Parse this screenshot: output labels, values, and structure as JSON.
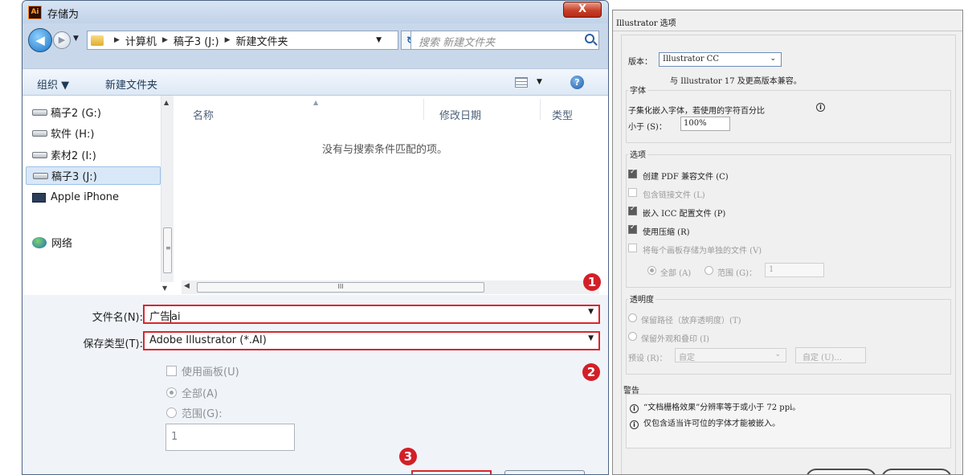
{
  "save_dialog": {
    "title": "存储为",
    "app_icon_text": "Ai",
    "close_glyph": "X",
    "breadcrumb": [
      "计算机",
      "稿子3 (J:)",
      "新建文件夹"
    ],
    "search_placeholder": "搜索 新建文件夹",
    "toolbar": {
      "organize": "组织 ▼",
      "new_folder": "新建文件夹"
    },
    "nav_items": [
      {
        "label": "稿子2 (G:)"
      },
      {
        "label": "软件 (H:)"
      },
      {
        "label": "素材2 (I:)"
      },
      {
        "label": "稿子3 (J:)"
      },
      {
        "label": "Apple iPhone"
      },
      {
        "label": "网络"
      }
    ],
    "columns": {
      "name": "名称",
      "modified": "修改日期",
      "type": "类型"
    },
    "empty_message": "没有与搜索条件匹配的项。",
    "filename_label": "文件名(N):",
    "filename_before_caret": "广告",
    "filename_after_caret": "ai",
    "savetype_label": "保存类型(T):",
    "savetype_value": "Adobe Illustrator (*.AI)",
    "use_artboards": "使用画板(U)",
    "all": "全部(A)",
    "range": "范围(G):",
    "range_value": "1",
    "scroll_mark": "III",
    "split_mark": "≡"
  },
  "badges": [
    "1",
    "2",
    "3"
  ],
  "options_dialog": {
    "title": "Illustrator 选项",
    "version_label": "版本：",
    "version_value": "Illustrator CC",
    "compat_note": "与 Illustrator 17 及更高版本兼容。",
    "fonts_group": "字体",
    "subset_text": "子集化嵌入字体，若使用的字符百分比",
    "less_than": "小于 (S)：",
    "percent_value": "100%",
    "options_group": "选项",
    "opt_pdf": "创建 PDF 兼容文件 (C)",
    "opt_linked": "包含链接文件 (L)",
    "opt_icc": "嵌入 ICC 配置文件 (P)",
    "opt_compress": "使用压缩 (R)",
    "opt_each_artboard": "将每个画板存储为单独的文件 (V)",
    "opt_all": "全部 (A)",
    "opt_range": "范围 (G)：",
    "opt_range_value": "1",
    "transparency_group": "透明度",
    "keep_paths": "保留路径（放弃透明度）(T)",
    "keep_appearance": "保留外观和叠印 (I)",
    "preset_label": "预设 (R)：",
    "preset_value": "自定",
    "custom_button": "自定 (U)...",
    "warnings_group": "警告",
    "warning1": "“文档栅格效果”分辨率等于或小于 72 ppi。",
    "warning2": "仅包含适当许可位的字体才能被嵌入。"
  },
  "colors": {
    "highlight": "#d9262e",
    "badge": "#d31f28",
    "window_chrome": "#c8d8ea"
  }
}
